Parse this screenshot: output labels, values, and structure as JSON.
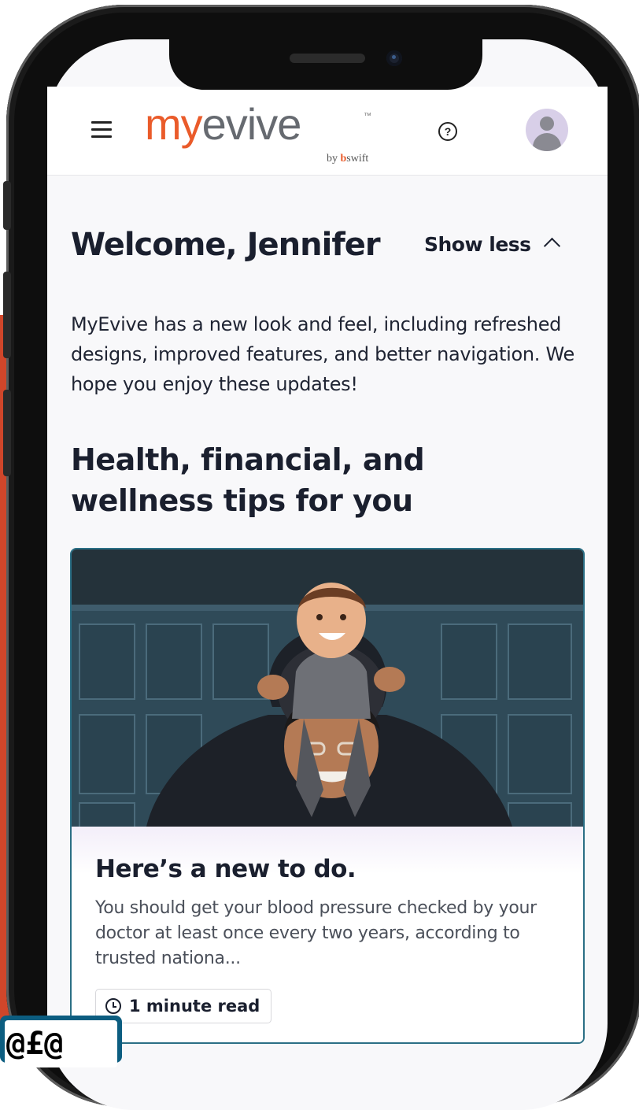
{
  "app": {
    "logo_my": "my",
    "logo_evive": "evive",
    "logo_tm": "™",
    "logo_by": "by",
    "logo_bswift_b": "b",
    "logo_bswift_rest": "swift"
  },
  "header": {
    "menu_icon": "hamburger-menu-icon",
    "help_icon": "question-circle-icon",
    "help_glyph": "?",
    "avatar_icon": "user-avatar-icon"
  },
  "welcome": {
    "title": "Welcome, Jennifer",
    "toggle_label": "Show less",
    "toggle_icon": "chevron-up-icon",
    "message": "MyEvive has a new look and feel, including refreshed designs, improved features, and better navigation. We hope you enjoy these updates!"
  },
  "tips": {
    "section_title": "Health, financial, and wellness tips for you",
    "card": {
      "image": "photo of smiling father carrying laughing toddler on his shoulders",
      "title": "Here’s a new to do.",
      "description": "You should get your blood pressure checked by your doctor at least once every two years, according to trusted nationa...",
      "badge_icon": "clock-icon",
      "badge_text": "1 minute read"
    }
  },
  "overlay": {
    "corner_fragment": "@£@"
  },
  "colors": {
    "brand_orange": "#ea5b2a",
    "logo_gray": "#666a70",
    "card_border": "#2b6f85",
    "page_bg": "#f8f8fa",
    "text_dark": "#1a1f2e"
  }
}
